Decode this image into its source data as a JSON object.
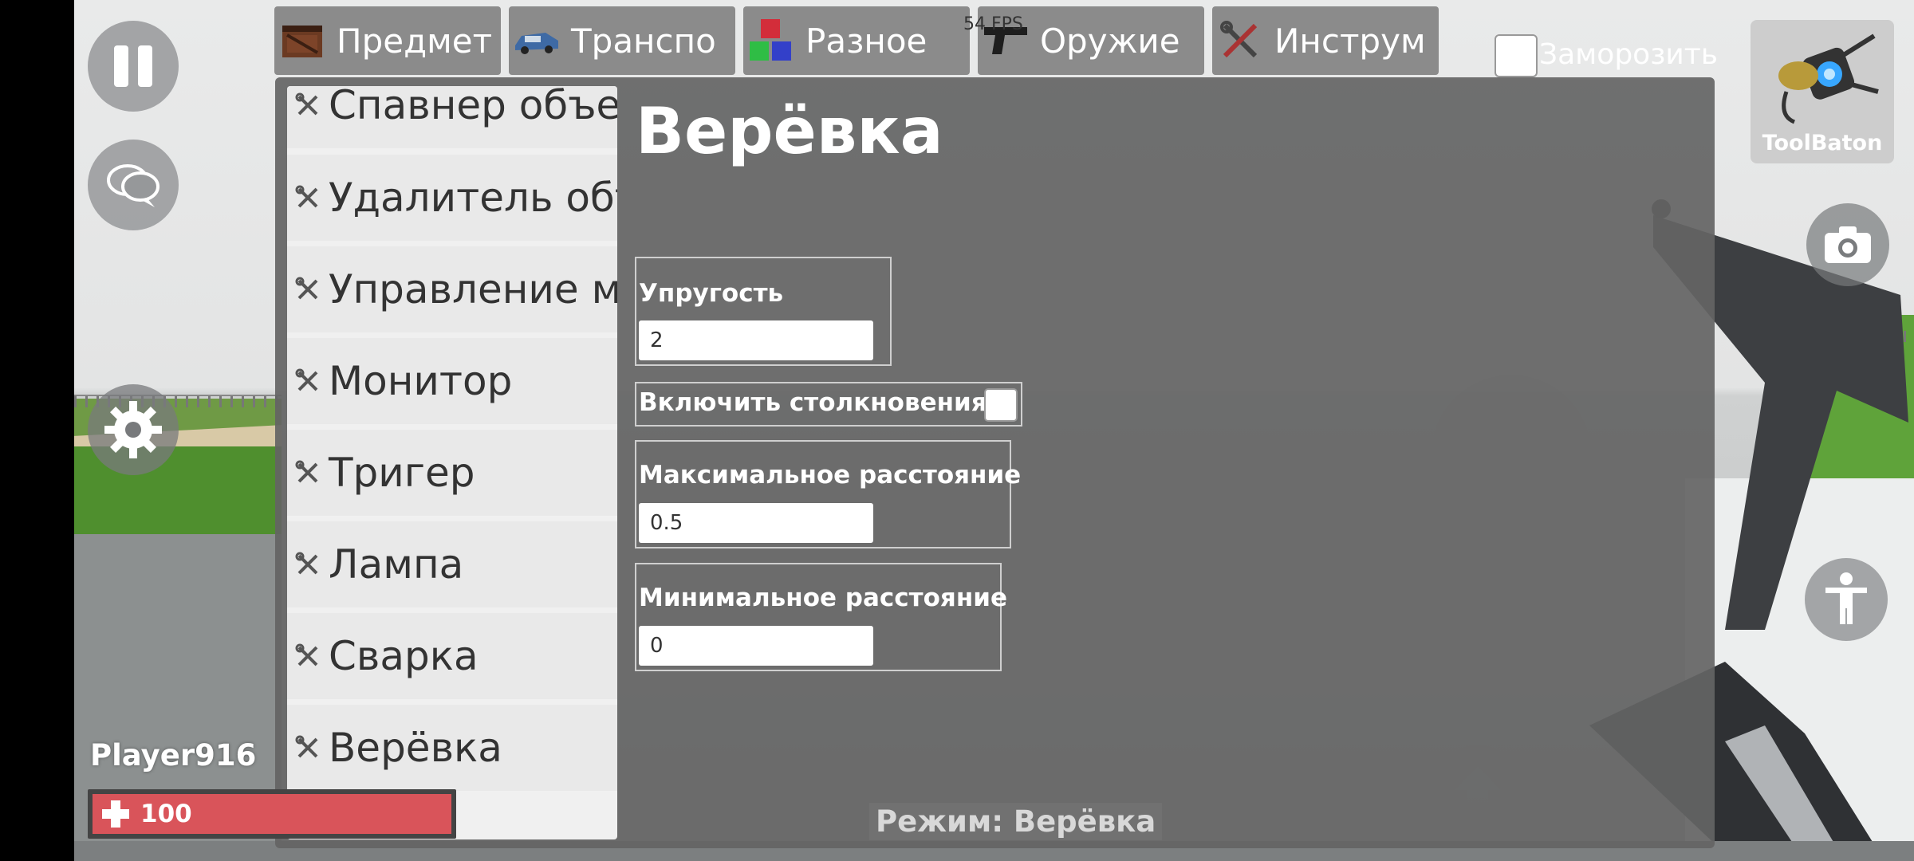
{
  "hud": {
    "fps": "54 FPS",
    "player_name": "Player916",
    "health": "100",
    "health_fraction": 1.0,
    "mode_label": "Режим: Верёвка"
  },
  "tabs": [
    {
      "label": "Предмет",
      "icon": "crate-icon"
    },
    {
      "label": "Транспо",
      "icon": "car-icon"
    },
    {
      "label": "Разное",
      "icon": "cubes-icon"
    },
    {
      "label": "Оружие",
      "icon": "pistol-icon"
    },
    {
      "label": "Инструм",
      "icon": "tools-icon"
    }
  ],
  "freeze": {
    "label": "Заморозить",
    "checked": false
  },
  "toolbaton": {
    "label": "ToolBaton",
    "icon": "toolbaton-icon"
  },
  "tool_list": [
    {
      "label": "Спавнер объектов"
    },
    {
      "label": "Удалитель объектов"
    },
    {
      "label": "Управление моделями"
    },
    {
      "label": "Монитор"
    },
    {
      "label": "Тригер"
    },
    {
      "label": "Лампа"
    },
    {
      "label": "Сварка"
    },
    {
      "label": "Верёвка"
    }
  ],
  "panel": {
    "title": "Верёвка",
    "elasticity_label": "Упругость",
    "elasticity_value": "2",
    "collisions_label": "Включить столкновения",
    "collisions_checked": false,
    "max_distance_label": "Максимальное расстояние",
    "max_distance_value": "0.5",
    "min_distance_label": "Минимальное расстояние",
    "min_distance_value": "0"
  },
  "colors": {
    "panel_bg": "#646464",
    "tab_bg": "#8b8b8b",
    "health_fill": "#d9545a",
    "grass": "#5fa33a"
  }
}
